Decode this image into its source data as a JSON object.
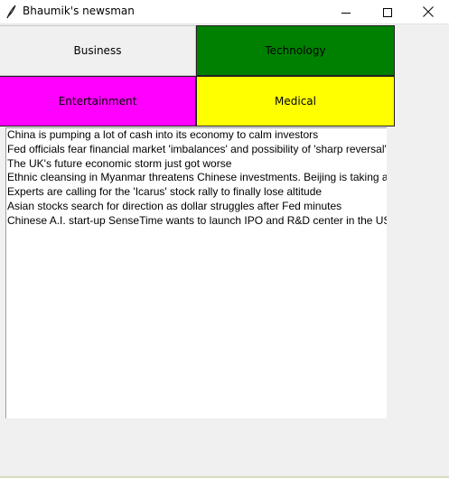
{
  "window": {
    "title": "Bhaumik's newsman"
  },
  "buttons": [
    {
      "label": "Business",
      "bg": "#f0f0f0"
    },
    {
      "label": "Technology",
      "bg": "#008000"
    },
    {
      "label": "Entertainment",
      "bg": "#ff00ff"
    },
    {
      "label": "Medical",
      "bg": "#ffff00"
    }
  ],
  "headlines": [
    "China is pumping a lot of cash into its economy to calm investors",
    "Fed officials fear financial market 'imbalances' and possibility of 'sharp reversal'",
    "The UK's future economic storm just got worse",
    "Ethnic cleansing in Myanmar threatens Chinese investments. Beijing is taking ac",
    "Experts are calling for the 'Icarus' stock rally to finally lose altitude",
    "Asian stocks search for direction as dollar struggles after Fed minutes",
    "Chinese A.I. start-up SenseTime wants to launch IPO and R&D center in the US"
  ],
  "icons": {
    "app": "feather-icon",
    "minimize": "minimize-icon",
    "maximize": "maximize-icon",
    "close": "close-icon"
  }
}
